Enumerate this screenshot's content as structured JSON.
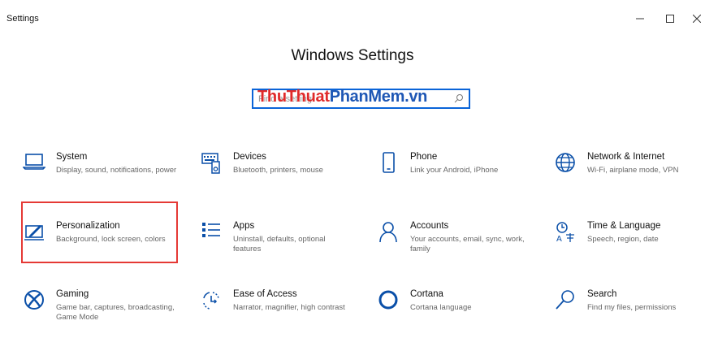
{
  "window": {
    "title": "Settings",
    "controls": [
      "minimize",
      "maximize",
      "close"
    ]
  },
  "heading": "Windows Settings",
  "search": {
    "placeholder": "Find a setting",
    "value": ""
  },
  "watermark": {
    "part1": "ThuThuat",
    "part2": "PhanMem",
    "part3": ".vn"
  },
  "tiles": [
    {
      "label": "System",
      "description": "Display, sound, notifications, power",
      "icon": "laptop-icon"
    },
    {
      "label": "Devices",
      "description": "Bluetooth, printers, mouse",
      "icon": "devices-icon"
    },
    {
      "label": "Phone",
      "description": "Link your Android, iPhone",
      "icon": "phone-icon"
    },
    {
      "label": "Network & Internet",
      "description": "Wi-Fi, airplane mode, VPN",
      "icon": "globe-icon"
    },
    {
      "label": "Personalization",
      "description": "Background, lock screen, colors",
      "icon": "personalization-icon"
    },
    {
      "label": "Apps",
      "description": "Uninstall, defaults, optional features",
      "icon": "apps-list-icon"
    },
    {
      "label": "Accounts",
      "description": "Your accounts, email, sync, work, family",
      "icon": "person-icon"
    },
    {
      "label": "Time & Language",
      "description": "Speech, region, date",
      "icon": "time-language-icon"
    },
    {
      "label": "Gaming",
      "description": "Game bar, captures, broadcasting, Game Mode",
      "icon": "xbox-icon"
    },
    {
      "label": "Ease of Access",
      "description": "Narrator, magnifier, high contrast",
      "icon": "ease-of-access-icon"
    },
    {
      "label": "Cortana",
      "description": "Cortana language",
      "icon": "cortana-icon"
    },
    {
      "label": "Search",
      "description": "Find my files, permissions",
      "icon": "search-icon"
    }
  ],
  "highlighted_tile": "Personalization",
  "colors": {
    "accent": "#0a64d8",
    "highlight": "#e53935",
    "icon": "#0a4fa8"
  }
}
